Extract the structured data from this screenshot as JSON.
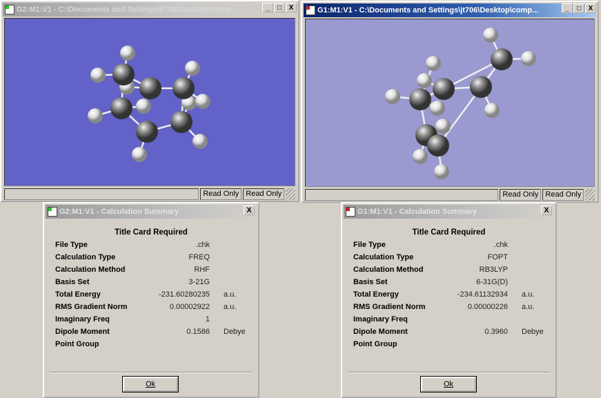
{
  "windows": [
    {
      "title": "G2:M1:V1 - C:\\Documents and Settings\\jt706\\Desktop\\comp...",
      "status": [
        "Read Only",
        "Read Only"
      ],
      "background": "#6262c8",
      "active": false
    },
    {
      "title": "G1:M1:V1 - C:\\Documents and Settings\\jt706\\Desktop\\comp...",
      "status": [
        "Read Only",
        "Read Only"
      ],
      "background": "#9a9ad0",
      "active": true
    }
  ],
  "title_buttons": {
    "minimize": "_",
    "maximize": "□",
    "close": "X"
  },
  "dialogs": [
    {
      "title": "G2:M1:V1 - Calculation Summary",
      "heading": "Title Card Required",
      "ok": "Ok",
      "close": "X",
      "rows": [
        {
          "label": "File Type",
          "value": ".chk",
          "unit": ""
        },
        {
          "label": "Calculation Type",
          "value": "FREQ",
          "unit": ""
        },
        {
          "label": "Calculation Method",
          "value": "RHF",
          "unit": ""
        },
        {
          "label": "Basis Set",
          "value": "3-21G",
          "unit": ""
        },
        {
          "label": "Total Energy",
          "value": "-231.60280235",
          "unit": "a.u."
        },
        {
          "label": "RMS Gradient Norm",
          "value": "0.00002922",
          "unit": "a.u."
        },
        {
          "label": "Imaginary Freq",
          "value": "1",
          "unit": ""
        },
        {
          "label": "Dipole Moment",
          "value": "0.1586",
          "unit": "Debye"
        },
        {
          "label": "Point Group",
          "value": "",
          "unit": ""
        }
      ]
    },
    {
      "title": "G1:M1:V1 - Calculation Summary",
      "heading": "Title Card Required",
      "ok": "Ok",
      "close": "X",
      "rows": [
        {
          "label": "File Type",
          "value": ".chk",
          "unit": ""
        },
        {
          "label": "Calculation Type",
          "value": "FOPT",
          "unit": ""
        },
        {
          "label": "Calculation Method",
          "value": "RB3LYP",
          "unit": ""
        },
        {
          "label": "Basis Set",
          "value": "6-31G(D)",
          "unit": ""
        },
        {
          "label": "Total Energy",
          "value": "-234.61132934",
          "unit": "a.u."
        },
        {
          "label": "RMS Gradient Norm",
          "value": "0.00000226",
          "unit": "a.u."
        },
        {
          "label": "Imaginary Freq",
          "value": "",
          "unit": ""
        },
        {
          "label": "Dipole Moment",
          "value": "0.3960",
          "unit": "Debye"
        },
        {
          "label": "Point Group",
          "value": "",
          "unit": ""
        }
      ]
    }
  ]
}
